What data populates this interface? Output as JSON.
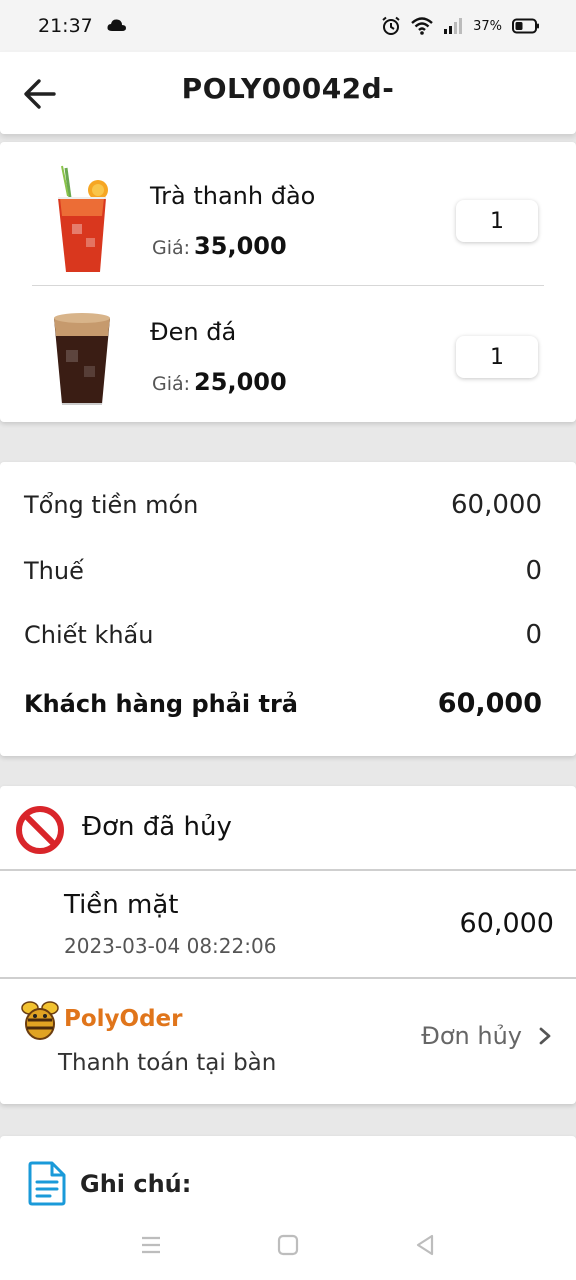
{
  "status_bar": {
    "time": "21:37",
    "battery": "37%",
    "icons": [
      "cloud-icon",
      "alarm-icon",
      "wifi-icon",
      "signal-icon",
      "battery-icon"
    ]
  },
  "header": {
    "title": "POLY00042d-",
    "back_icon": "arrow-left-icon"
  },
  "items": [
    {
      "name": "Trà thanh đào",
      "price_label": "Giá:",
      "price": "35,000",
      "quantity": "1",
      "image_icon": "peach-tea-image"
    },
    {
      "name": "Đen đá",
      "price_label": "Giá:",
      "price": "25,000",
      "quantity": "1",
      "image_icon": "iced-coffee-image"
    }
  ],
  "totals": {
    "subtotal_label": "Tổng tiền món",
    "subtotal_value": "60,000",
    "tax_label": "Thuế",
    "tax_value": "0",
    "discount_label": "Chiết khấu",
    "discount_value": "0",
    "total_label": "Khách hàng phải trả",
    "total_value": "60,000"
  },
  "order_status": {
    "status_text": "Đơn đã hủy",
    "status_icon": "cancel-circle-icon",
    "status_color": "#d9252a"
  },
  "payment": {
    "method": "Tiền mặt",
    "timestamp": "2023-03-04 08:22:06",
    "amount": "60,000"
  },
  "channel": {
    "brand": "PolyOder",
    "brand_color": "#e0751b",
    "subtitle": "Thanh toán tại bàn",
    "action_label": "Đơn hủy",
    "action_icon": "chevron-right-icon"
  },
  "note": {
    "label": "Ghi chú:",
    "icon": "document-icon",
    "icon_color": "#1a9ad9"
  },
  "nav": {
    "icons": [
      "menu-icon",
      "home-icon",
      "back-triangle-icon"
    ]
  }
}
